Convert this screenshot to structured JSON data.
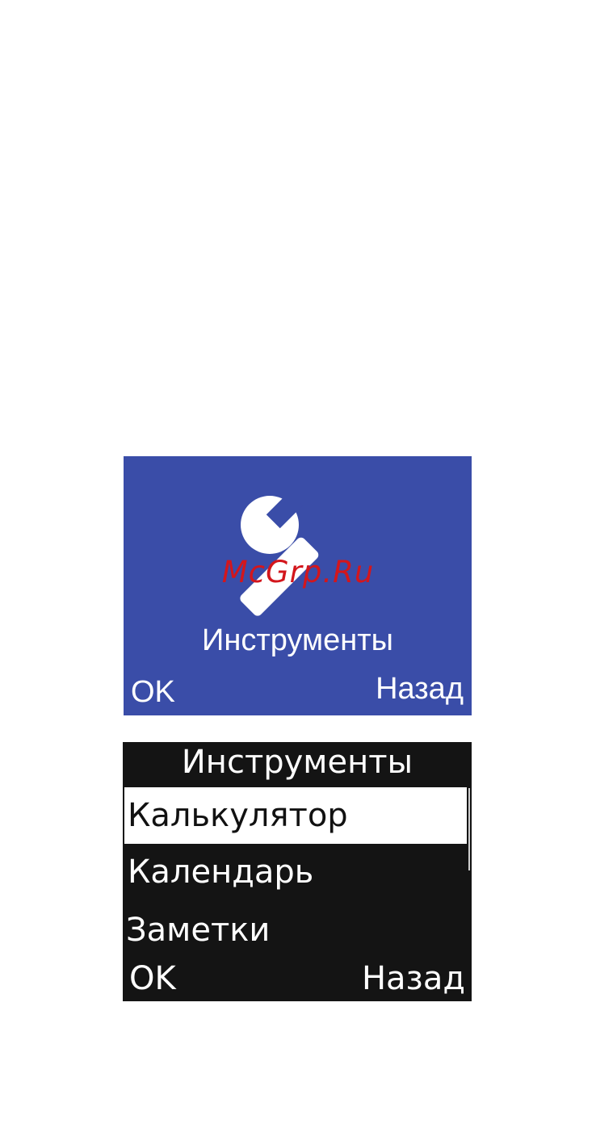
{
  "tools_screen": {
    "title": "Инструменты",
    "icon": "wrench-icon",
    "softkey_left": "OK",
    "softkey_right": "Назад",
    "background_color": "#3a4da8"
  },
  "watermark": "McGrp.Ru",
  "menu_screen": {
    "title": "Инструменты",
    "items": [
      {
        "label": "Калькулятор",
        "selected": true
      },
      {
        "label": "Календарь",
        "selected": false
      },
      {
        "label": "Заметки",
        "selected": false
      }
    ],
    "softkey_left": "OK",
    "softkey_right": "Назад",
    "background_color": "#141414"
  }
}
